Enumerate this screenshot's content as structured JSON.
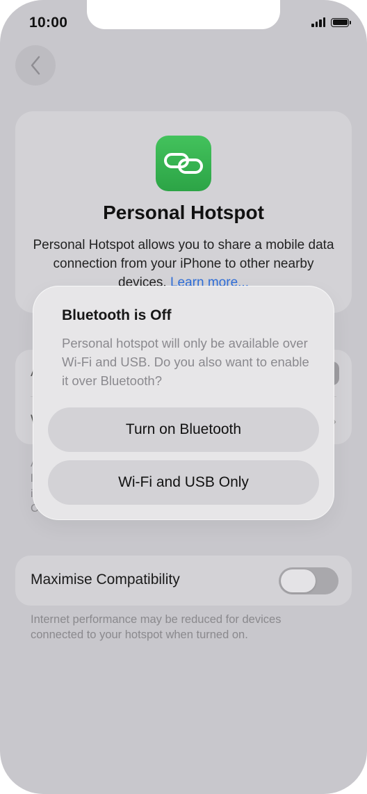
{
  "status_bar": {
    "time": "10:00",
    "icons": [
      "cellular-signal-icon",
      "battery-icon"
    ]
  },
  "nav": {
    "back_icon": "chevron-left-icon"
  },
  "hotspot": {
    "icon": "link-icon",
    "title": "Personal Hotspot",
    "description": "Personal Hotspot allows you to share a mobile data connection from your iPhone to other nearby devices.",
    "link_text": "Learn more..."
  },
  "obscured_rows": {
    "row1_initial": "A",
    "row2_initial": "W"
  },
  "obscured_text": {
    "lines": [
      "A",
      "l",
      "i",
      "Co"
    ]
  },
  "compatibility": {
    "label": "Maximise Compatibility",
    "enabled": false,
    "footnote": "Internet performance may be reduced for devices connected to your hotspot when turned on."
  },
  "alert": {
    "title": "Bluetooth is Off",
    "message": "Personal hotspot will only be available over Wi-Fi and USB. Do you also want to enable it over Bluetooth?",
    "buttons": [
      "Turn on Bluetooth",
      "Wi-Fi and USB Only"
    ]
  },
  "colors": {
    "accent_green": "#34b550",
    "link_blue": "#2f6ed8",
    "background": "#c8c7cc"
  }
}
